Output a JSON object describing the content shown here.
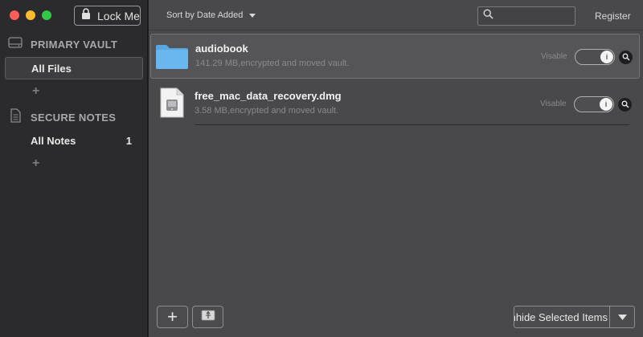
{
  "window": {
    "lock_label": "Lock Me"
  },
  "sidebar": {
    "sections": [
      {
        "title": "PRIMARY VAULT",
        "icon": "drive-icon",
        "items": [
          {
            "label": "All Files",
            "count": ""
          }
        ]
      },
      {
        "title": "SECURE NOTES",
        "icon": "document-icon",
        "items": [
          {
            "label": "All Notes",
            "count": "1"
          }
        ]
      }
    ],
    "add_symbol": "+"
  },
  "toolbar": {
    "sort_label": "Sort by Date Added",
    "search_placeholder": "",
    "register_label": "Register"
  },
  "files": [
    {
      "name": "audiobook",
      "subtitle": "141.29 MB,encrypted and moved vault.",
      "icon": "folder-icon",
      "visibility_label": "Visable",
      "toggle_on": true
    },
    {
      "name": "free_mac_data_recovery.dmg",
      "subtitle": "3.58 MB,encrypted and moved vault.",
      "icon": "disk-image-icon",
      "visibility_label": "Visable",
      "toggle_on": true
    }
  ],
  "bottom": {
    "add_symbol": "+",
    "unhide_label": "Unhide Selected Items"
  },
  "colors": {
    "sidebar_bg": "#2b2b2d",
    "main_bg": "#49494c",
    "folder_blue": "#6ab6ee",
    "close": "#fc5f57",
    "minimize": "#fdbc2e",
    "zoom": "#33c748"
  }
}
